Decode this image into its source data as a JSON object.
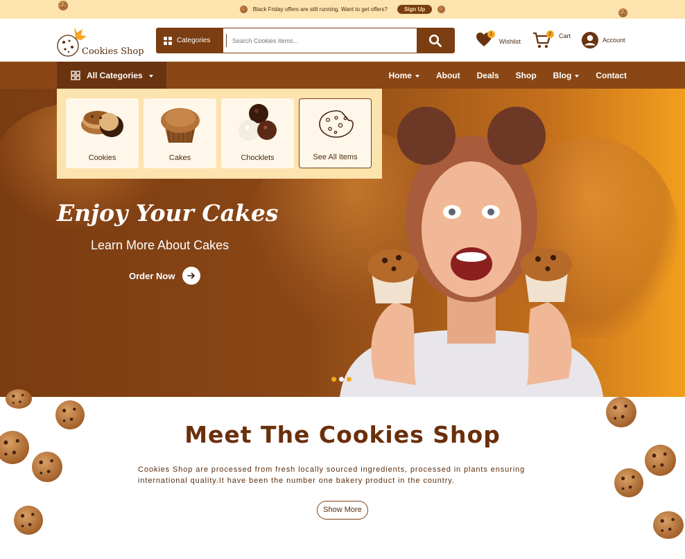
{
  "promo": {
    "text": "Black Friday offers are still running. Want to get offers?",
    "button": "Sign Up"
  },
  "logo": {
    "text": "Cookies Shop"
  },
  "search": {
    "category_label": "Categories",
    "placeholder": "Search Cookies items..."
  },
  "header": {
    "wishlist": {
      "label": "Wishlist",
      "count": "1"
    },
    "cart": {
      "label": "Cart",
      "count": "2"
    },
    "account": {
      "label": "Account"
    }
  },
  "nav": {
    "all_categories": "All Categories",
    "items": [
      {
        "label": "Home",
        "has_dropdown": true
      },
      {
        "label": "About",
        "has_dropdown": false
      },
      {
        "label": "Deals",
        "has_dropdown": false
      },
      {
        "label": "Shop",
        "has_dropdown": false
      },
      {
        "label": "Blog",
        "has_dropdown": true
      },
      {
        "label": "Contact",
        "has_dropdown": false
      }
    ]
  },
  "dropdown": {
    "categories": [
      {
        "label": "Cookies",
        "icon": "cookies-image"
      },
      {
        "label": "Cakes",
        "icon": "cupcake-image"
      },
      {
        "label": "Chocklets",
        "icon": "chocolates-image"
      },
      {
        "label": "See All Items",
        "icon": "cookie-outline-icon"
      }
    ]
  },
  "hero": {
    "title": "Enjoy Your Cakes",
    "subtitle": "Learn More About Cakes",
    "cta": "Order Now",
    "slides": 3,
    "active_slide": 2
  },
  "meet": {
    "title": "Meet The Cookies Shop",
    "text": "Cookies Shop are processed from fresh locally sourced ingredients, processed in plants ensuring international quality.It have been the number one bakery product in the country.",
    "button": "Show More"
  },
  "colors": {
    "brand_brown": "#7a3e12",
    "accent_orange": "#f5a623",
    "promo_bg": "#fde3ae",
    "title_brown": "#6a2f0b"
  }
}
